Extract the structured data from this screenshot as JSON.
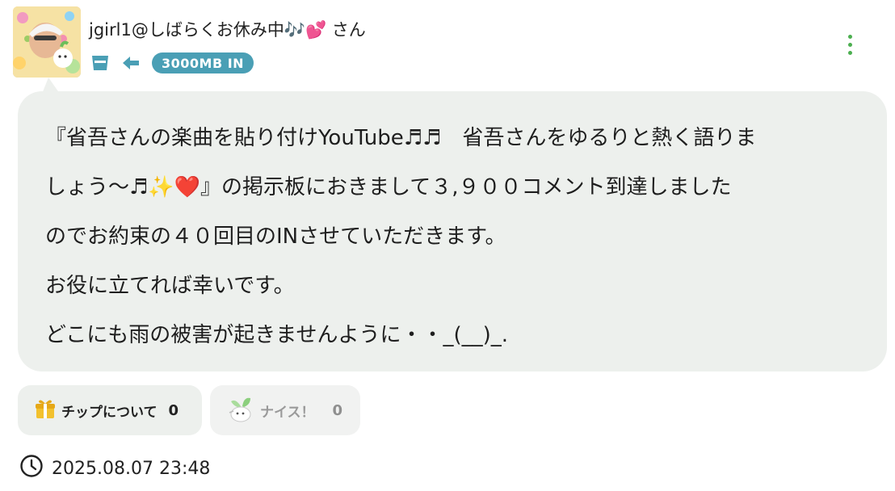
{
  "post": {
    "author": {
      "display_name": "jgirl1@しばらくお休み中🎶💕 さん",
      "transfer_badge": "3000MB IN",
      "cup_icon": "cup-icon",
      "arrow_icon": "arrow-left-icon"
    },
    "message_lines": [
      "『省吾さんの楽曲を貼り付けYouTube♬♬　省吾さんをゆるりと熱く語りま",
      "しょう〜♬✨❤️』の掲示板におきまして３,９００コメント到達しました",
      "のでお約束の４０回目のINさせていただきます。",
      "お役に立てれば幸いです。",
      "どこにも雨の被害が起きませんように・・_(__)_."
    ],
    "reactions": {
      "tip": {
        "label": "チップについて",
        "count": "0",
        "icon": "gift-icon"
      },
      "nice": {
        "label": "ナイス！",
        "count": "0",
        "icon": "nice-character-icon"
      }
    },
    "timestamp": "2025.08.07 23:48",
    "timestamp_icon": "clock-icon",
    "more_icon": "more-vertical-icon"
  },
  "colors": {
    "bubble_bg": "#edf0ed",
    "badge_bg": "#4a9fb5",
    "accent_icon": "#4a9fb5",
    "menu_dots": "#4caf50"
  }
}
